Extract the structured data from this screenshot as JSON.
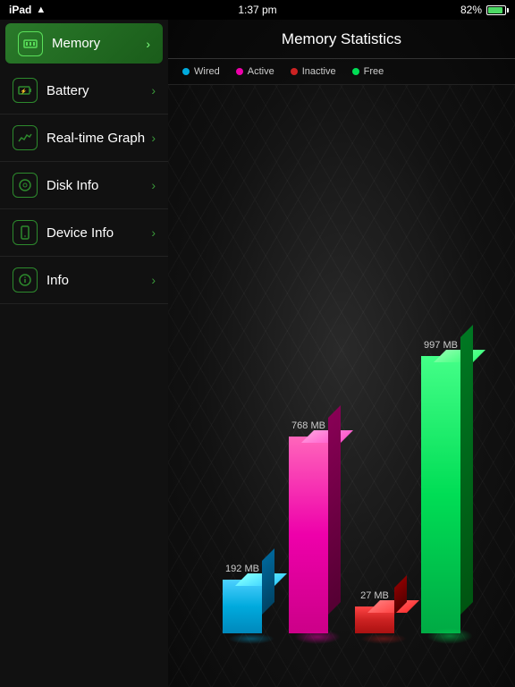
{
  "statusBar": {
    "device": "iPad",
    "time": "1:37 pm",
    "battery": "82%"
  },
  "sidebar": {
    "items": [
      {
        "id": "memory",
        "label": "Memory",
        "active": true
      },
      {
        "id": "battery",
        "label": "Battery",
        "active": false
      },
      {
        "id": "realtime",
        "label": "Real-time Graph",
        "active": false
      },
      {
        "id": "disk",
        "label": "Disk Info",
        "active": false
      },
      {
        "id": "device",
        "label": "Device Info",
        "active": false
      },
      {
        "id": "info",
        "label": "Info",
        "active": false
      }
    ]
  },
  "content": {
    "title": "Memory Statistics",
    "legend": [
      {
        "id": "wired",
        "label": "Wired",
        "color": "#00aadd"
      },
      {
        "id": "active",
        "label": "Active",
        "color": "#ee00aa"
      },
      {
        "id": "inactive",
        "label": "Inactive",
        "color": "#cc2222"
      },
      {
        "id": "free",
        "label": "Free",
        "color": "#00dd55"
      }
    ],
    "bars": [
      {
        "id": "wired",
        "label": "192 MB",
        "color": "#00aadd"
      },
      {
        "id": "active",
        "label": "768 MB",
        "color": "#ee00aa"
      },
      {
        "id": "inactive",
        "label": "27 MB",
        "color": "#cc2222"
      },
      {
        "id": "free",
        "label": "997 MB",
        "color": "#00dd55"
      }
    ]
  }
}
